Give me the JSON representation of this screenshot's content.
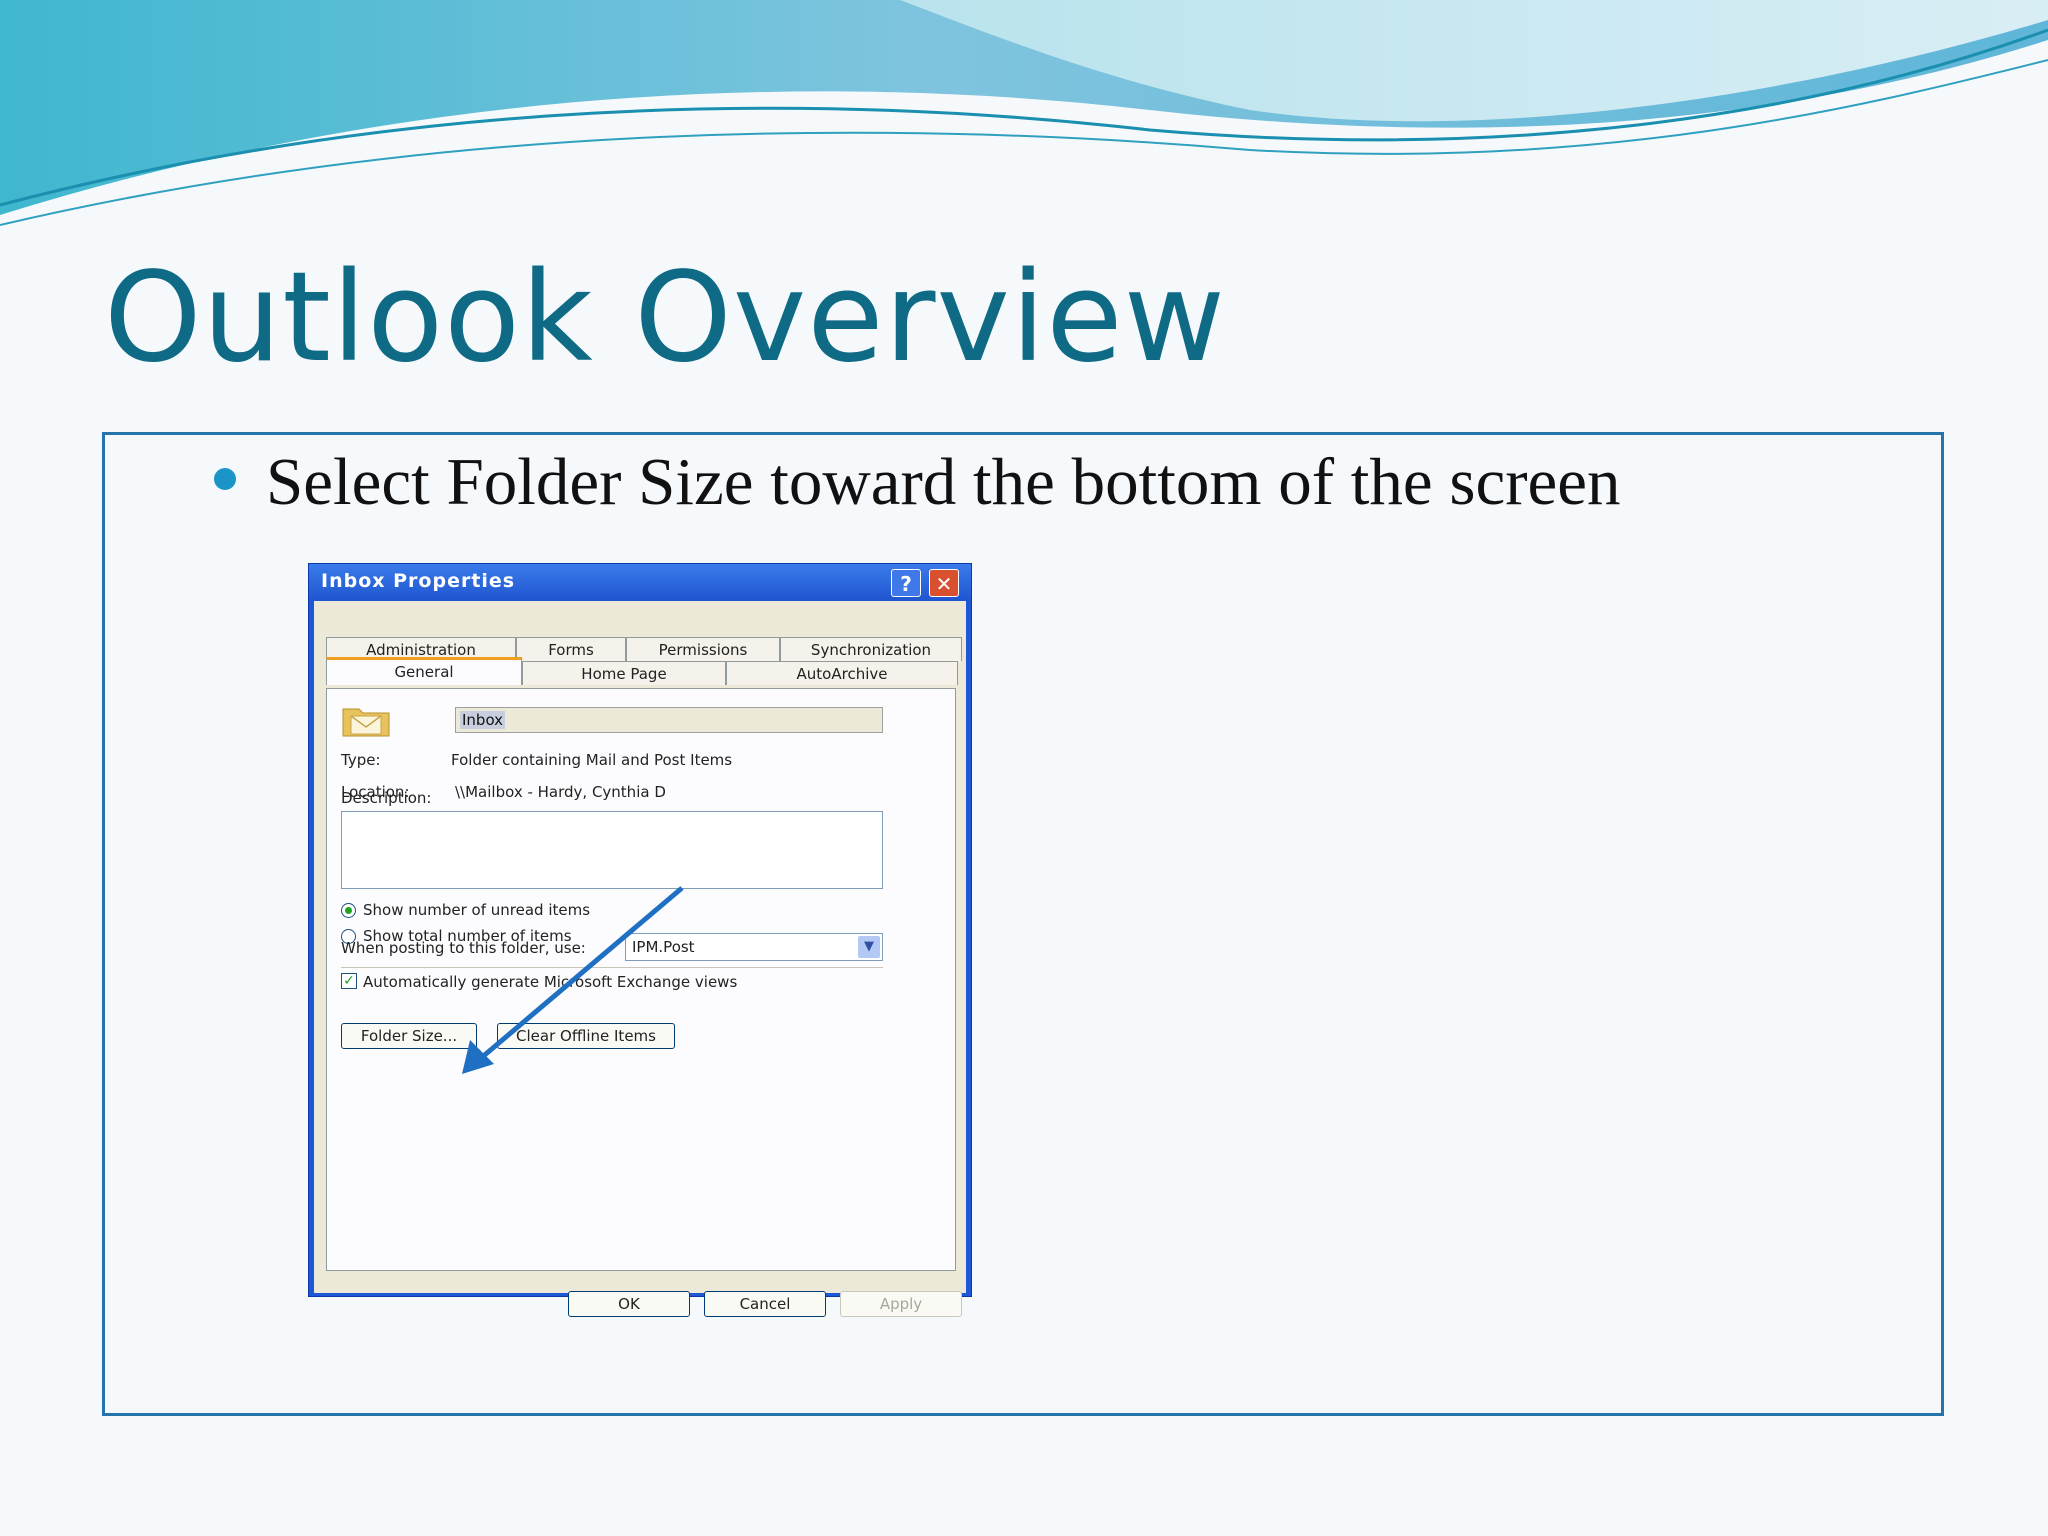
{
  "slide": {
    "title": "Outlook Overview",
    "bullet": "Select Folder Size toward the bottom of the screen",
    "colors": {
      "title": "#0e6a85",
      "border": "#2574ae",
      "bullet": "#1b94c8",
      "arrow": "#1f6fc2"
    }
  },
  "dialog": {
    "title": "Inbox Properties",
    "help_glyph": "?",
    "close_glyph": "✕",
    "tabs_row1": [
      "Administration",
      "Forms",
      "Permissions",
      "Synchronization"
    ],
    "tabs_row2": [
      "General",
      "Home Page",
      "AutoArchive"
    ],
    "active_tab": "General",
    "folder_name": "Inbox",
    "type_label": "Type:",
    "type_value": "Folder containing Mail and Post Items",
    "location_label": "Location:",
    "location_value": "\\\\Mailbox - Hardy, Cynthia D",
    "description_label": "Description:",
    "radio_unread": "Show number of unread items",
    "radio_total": "Show total number of items",
    "posting_label": "When posting to this folder, use:",
    "posting_value": "IPM.Post",
    "auto_generate": "Automatically generate Microsoft Exchange views",
    "folder_size_button": "Folder Size...",
    "clear_offline_button": "Clear Offline Items",
    "ok_button": "OK",
    "cancel_button": "Cancel",
    "apply_button": "Apply"
  }
}
